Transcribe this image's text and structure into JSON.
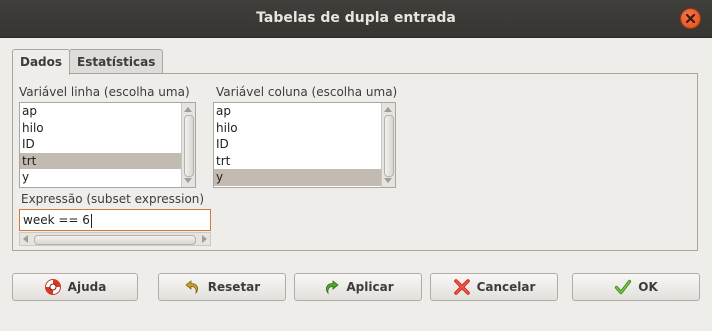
{
  "window": {
    "title": "Tabelas de dupla entrada"
  },
  "tabs": [
    {
      "label": "Dados",
      "active": true
    },
    {
      "label": "Estatísticas",
      "active": false
    }
  ],
  "row_variable": {
    "label": "Variável linha (escolha uma)",
    "items": [
      "ap",
      "hilo",
      "ID",
      "trt",
      "y"
    ],
    "selected": "trt"
  },
  "col_variable": {
    "label": "Variável coluna (escolha uma)",
    "items": [
      "ap",
      "hilo",
      "ID",
      "trt",
      "y"
    ],
    "selected": "y"
  },
  "subset": {
    "label": "Expressão (subset expression)",
    "value": "week == 6"
  },
  "buttons": {
    "help": "Ajuda",
    "reset": "Resetar",
    "apply": "Aplicar",
    "cancel": "Cancelar",
    "ok": "OK"
  },
  "icons": {
    "close": "close-icon",
    "help": "lifebuoy-icon",
    "reset": "undo-arrow-icon",
    "apply": "redo-arrow-icon",
    "cancel": "red-x-icon",
    "ok": "checkmark-icon"
  },
  "colors": {
    "titlebar": "#3c3b37",
    "close": "#e95420",
    "selection": "#c3bbb2",
    "focus_border": "#d37a3a"
  }
}
